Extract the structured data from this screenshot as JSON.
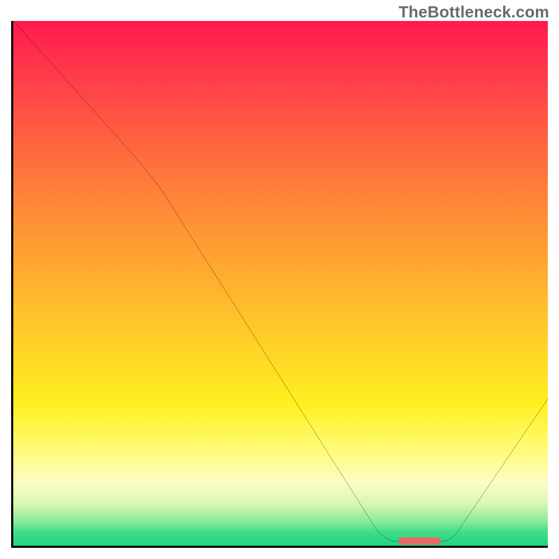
{
  "watermark": "TheBottleneck.com",
  "chart_data": {
    "type": "line",
    "title": "",
    "xlabel": "",
    "ylabel": "",
    "xlim": [
      0,
      100
    ],
    "ylim": [
      0,
      100
    ],
    "series": [
      {
        "name": "curve",
        "points": [
          {
            "x": 0,
            "y": 100
          },
          {
            "x": 22,
            "y": 75
          },
          {
            "x": 68,
            "y": 3
          },
          {
            "x": 72,
            "y": 0.8
          },
          {
            "x": 80,
            "y": 0.8
          },
          {
            "x": 84,
            "y": 4
          },
          {
            "x": 100,
            "y": 28
          }
        ]
      }
    ],
    "marker": {
      "x_start": 72,
      "x_end": 80,
      "y": 0.9
    },
    "gradient_stops": [
      {
        "pos": 0,
        "color": "#ff1a4d"
      },
      {
        "pos": 0.1,
        "color": "#ff3a4a"
      },
      {
        "pos": 0.22,
        "color": "#ff6040"
      },
      {
        "pos": 0.35,
        "color": "#ff8838"
      },
      {
        "pos": 0.48,
        "color": "#ffab30"
      },
      {
        "pos": 0.61,
        "color": "#ffcf28"
      },
      {
        "pos": 0.73,
        "color": "#fff020"
      },
      {
        "pos": 0.82,
        "color": "#fffb7a"
      },
      {
        "pos": 0.88,
        "color": "#fdfdc4"
      },
      {
        "pos": 0.92,
        "color": "#d9f7b0"
      },
      {
        "pos": 0.955,
        "color": "#86e99a"
      },
      {
        "pos": 0.975,
        "color": "#3fdc88"
      },
      {
        "pos": 1.0,
        "color": "#20d680"
      }
    ]
  }
}
